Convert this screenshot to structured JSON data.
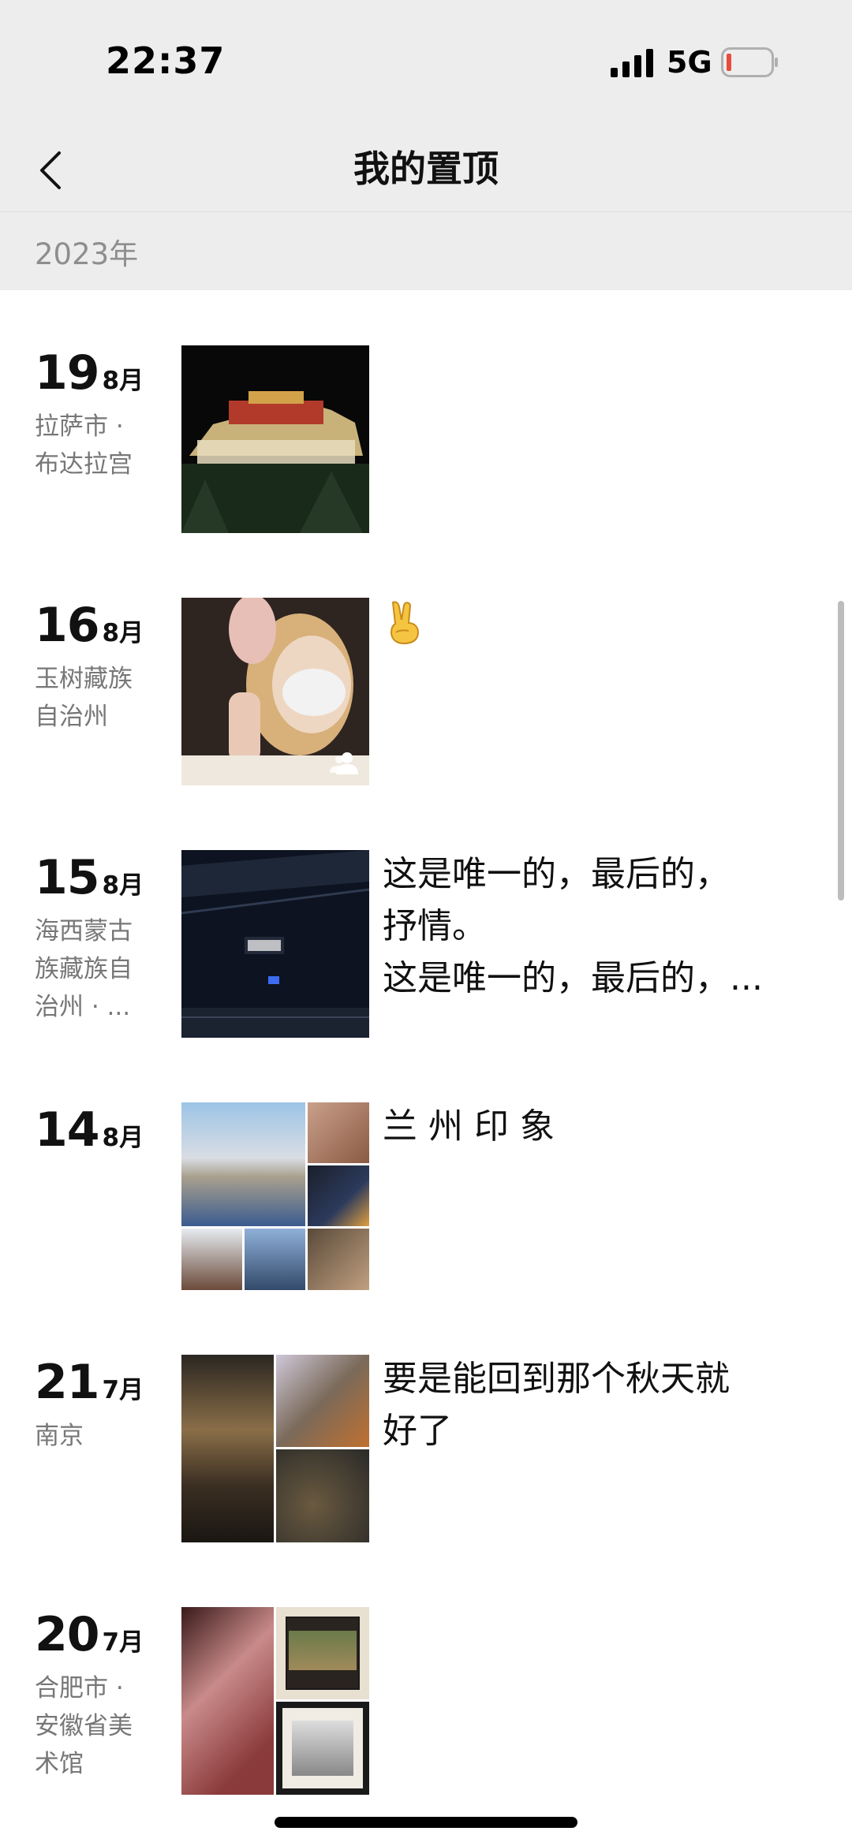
{
  "status_bar": {
    "time": "22:37",
    "network": "5G"
  },
  "nav": {
    "title": "我的置顶"
  },
  "year_header": "2023年",
  "entries": [
    {
      "day": "19",
      "month": "8月",
      "location": "拉萨市 · 布达拉宫",
      "caption": ""
    },
    {
      "day": "16",
      "month": "8月",
      "location": "玉树藏族自治州",
      "caption": ""
    },
    {
      "day": "15",
      "month": "8月",
      "location": "海西蒙古族藏族自治州 · ...",
      "caption": "这是唯一的，最后的，\n抒情。\n这是唯一的，最后的，..."
    },
    {
      "day": "14",
      "month": "8月",
      "location": "",
      "caption": "兰 州 印 象"
    },
    {
      "day": "21",
      "month": "7月",
      "location": "南京",
      "caption": "要是能回到那个秋天就\n好了"
    },
    {
      "day": "20",
      "month": "7月",
      "location": "合肥市 · 安徽省美术馆",
      "caption": ""
    }
  ],
  "icons": {
    "back": "chevron-left-icon",
    "signal": "signal-icon",
    "battery": "battery-low-icon",
    "emoji": "victory-hand-emoji",
    "contacts": "contacts-icon"
  },
  "colors": {
    "header_bg": "#ededed",
    "secondary_text": "#777777",
    "battery_low": "#e74c3c"
  }
}
